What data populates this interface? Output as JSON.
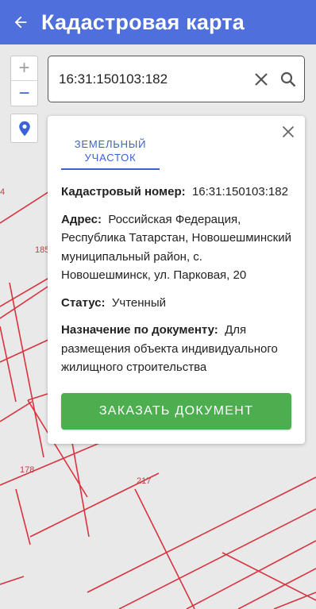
{
  "appbar": {
    "title": "Кадастровая карта",
    "back_icon": "arrow-left-icon"
  },
  "map": {
    "zoom_in_label": "+",
    "zoom_out_label": "−",
    "locate_icon": "map-pin-icon",
    "parcel_labels": [
      "4",
      "185",
      "178",
      "217"
    ],
    "parcel_line_color": "#d9333f"
  },
  "search": {
    "value": "16:31:150103:182",
    "clear_icon": "close-icon",
    "search_icon": "search-icon"
  },
  "info_card": {
    "tab_label": "ЗЕМЕЛЬНЫЙ УЧАСТОК",
    "cadastral_label": "Кадастровый номер:",
    "cadastral_value": "16:31:150103:182",
    "address_label": "Адрес:",
    "address_value": "Российская Федерация, Республика Татарстан, Новошешминский муниципальный район, с. Новошешминск, ул. Парковая, 20",
    "status_label": "Статус:",
    "status_value": "Учтенный",
    "purpose_label": "Назначение по документу:",
    "purpose_value": "Для размещения объекта индивидуального жилищного строительства",
    "order_button": "ЗАКАЗАТЬ ДОКУМЕНТ"
  },
  "colors": {
    "appbar": "#4f6fdc",
    "accent": "#3b62d8",
    "button": "#4cae4f"
  }
}
